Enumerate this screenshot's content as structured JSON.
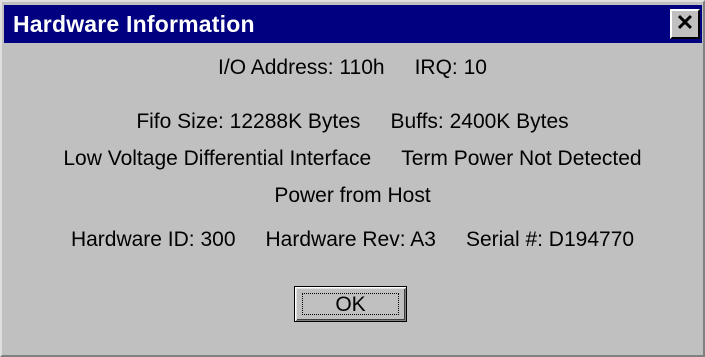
{
  "window": {
    "title": "Hardware Information",
    "close_label": "✕"
  },
  "info": {
    "io_address": "I/O Address: 110h",
    "irq": "IRQ: 10",
    "fifo_size": "Fifo Size: 12288K Bytes",
    "buffs": "Buffs: 2400K Bytes",
    "interface": "Low Voltage Differential Interface",
    "term_power": "Term Power Not Detected",
    "power_source": "Power from Host",
    "hardware_id": "Hardware ID: 300",
    "hardware_rev": "Hardware Rev: A3",
    "serial": "Serial #: D194770"
  },
  "buttons": {
    "ok_label": "OK"
  },
  "colors": {
    "titlebar": "#000080",
    "face": "#c0c0c0"
  }
}
